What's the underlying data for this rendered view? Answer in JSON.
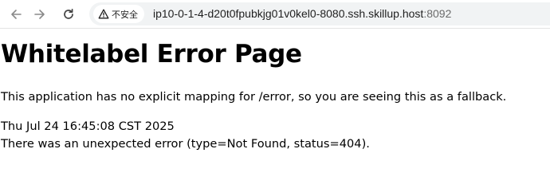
{
  "browser": {
    "security_label": "不安全",
    "url_host": "ip10-0-1-4-d20t0fpubkjg01v0kel0-8080.ssh.skillup.host",
    "url_port": ":8092",
    "icons": {
      "back": "back-arrow-icon",
      "forward": "forward-arrow-icon",
      "reload": "reload-icon",
      "security": "warning-triangle-icon"
    }
  },
  "page": {
    "title": "Whitelabel Error Page",
    "message": "This application has no explicit mapping for /error, so you are seeing this as a fallback.",
    "timestamp": "Thu Jul 24 16:45:08 CST 2025",
    "error_detail": "There was an unexpected error (type=Not Found, status=404)."
  }
}
